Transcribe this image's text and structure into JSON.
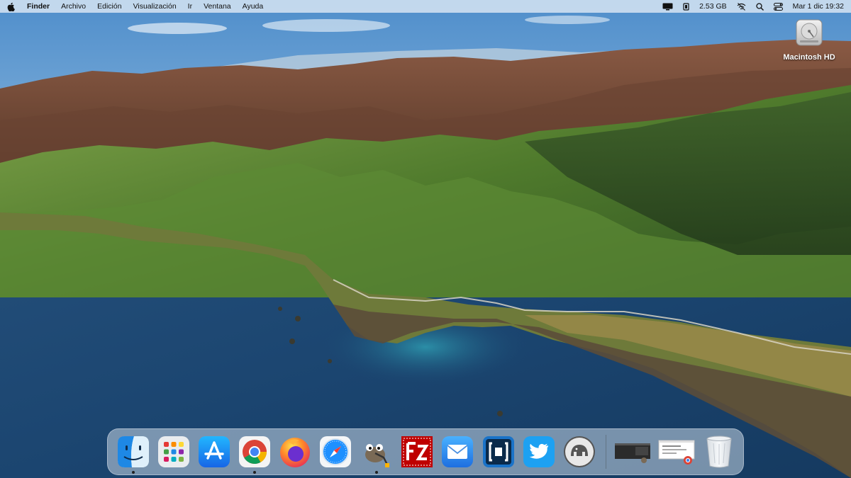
{
  "menubar": {
    "app_name": "Finder",
    "menus": [
      "Archivo",
      "Edición",
      "Visualización",
      "Ir",
      "Ventana",
      "Ayuda"
    ],
    "status": {
      "memory": "2.53 GB",
      "datetime": "Mar 1 dic  19:32"
    }
  },
  "desktop": {
    "icons": [
      {
        "label": "Macintosh HD",
        "icon": "hard-drive-icon"
      }
    ]
  },
  "dock": {
    "apps": [
      {
        "name": "finder",
        "icon": "finder-icon",
        "running": true
      },
      {
        "name": "launchpad",
        "icon": "launchpad-icon",
        "running": false
      },
      {
        "name": "app-store",
        "icon": "app-store-icon",
        "running": false
      },
      {
        "name": "chrome",
        "icon": "chrome-icon",
        "running": true
      },
      {
        "name": "firefox",
        "icon": "firefox-icon",
        "running": false
      },
      {
        "name": "safari",
        "icon": "safari-icon",
        "running": false
      },
      {
        "name": "gimp",
        "icon": "gimp-icon",
        "running": true
      },
      {
        "name": "filezilla",
        "icon": "filezilla-icon",
        "running": false
      },
      {
        "name": "mail",
        "icon": "mail-icon",
        "running": false
      },
      {
        "name": "codeshot",
        "icon": "square-bracket-app-icon",
        "running": false
      },
      {
        "name": "twitter",
        "icon": "twitter-icon",
        "running": false
      },
      {
        "name": "mamp",
        "icon": "elephant-icon",
        "running": false
      }
    ],
    "minimized": [
      "terminal-window-thumbnail",
      "chrome-window-thumbnail"
    ],
    "trash": {
      "icon": "trash-icon"
    }
  },
  "colors": {
    "menubar_bg": "#dce8f4",
    "sky": "#6ea6d6",
    "ocean": "#1f4a72",
    "hills_green": "#4e7a2e",
    "hills_brown": "#7a4a34"
  }
}
